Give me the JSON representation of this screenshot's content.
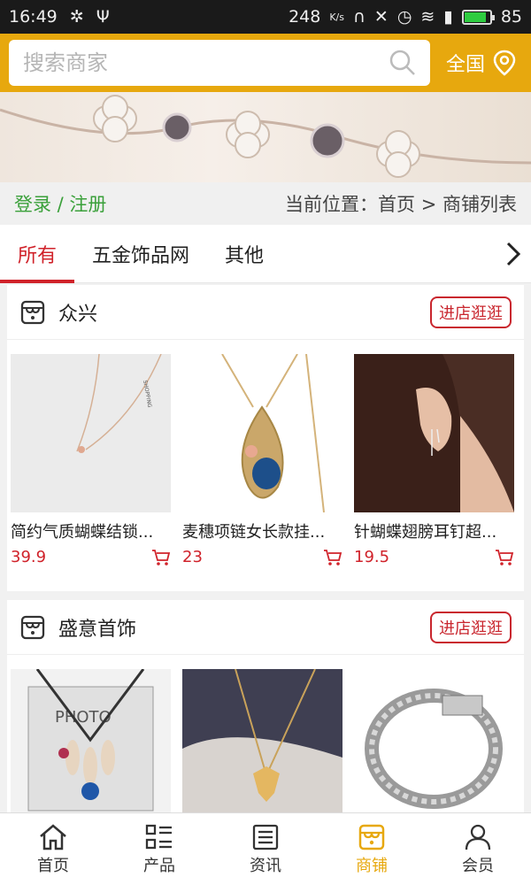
{
  "status": {
    "time": "16:49",
    "speed": "248",
    "speed_unit": "K/s",
    "battery": "85"
  },
  "search": {
    "placeholder": "搜索商家",
    "region": "全国"
  },
  "crumb": {
    "auth": "登录 / 注册",
    "location": "当前位置：首页 > 商铺列表"
  },
  "tabs": [
    {
      "label": "所有",
      "active": true
    },
    {
      "label": "五金饰品网",
      "active": false
    },
    {
      "label": "其他",
      "active": false
    }
  ],
  "shops": [
    {
      "name": "众兴",
      "enter_label": "进店逛逛",
      "products": [
        {
          "name": "简约气质蝴蝶结锁...",
          "price": "39.9"
        },
        {
          "name": "麦穗项链女长款挂...",
          "price": "23"
        },
        {
          "name": "针蝴蝶翅膀耳钉超...",
          "price": "19.5"
        }
      ]
    },
    {
      "name": "盛意首饰",
      "enter_label": "进店逛逛",
      "products": [
        {
          "name": "",
          "price": ""
        },
        {
          "name": "",
          "price": ""
        },
        {
          "name": "",
          "price": ""
        }
      ]
    }
  ],
  "nav": [
    {
      "label": "首页",
      "icon": "home-icon"
    },
    {
      "label": "产品",
      "icon": "list-icon"
    },
    {
      "label": "资讯",
      "icon": "news-icon"
    },
    {
      "label": "商铺",
      "icon": "shop-icon",
      "active": true
    },
    {
      "label": "会员",
      "icon": "user-icon"
    }
  ],
  "colors": {
    "accent": "#e7a80e",
    "red": "#d0222a",
    "green": "#3aa03a"
  }
}
